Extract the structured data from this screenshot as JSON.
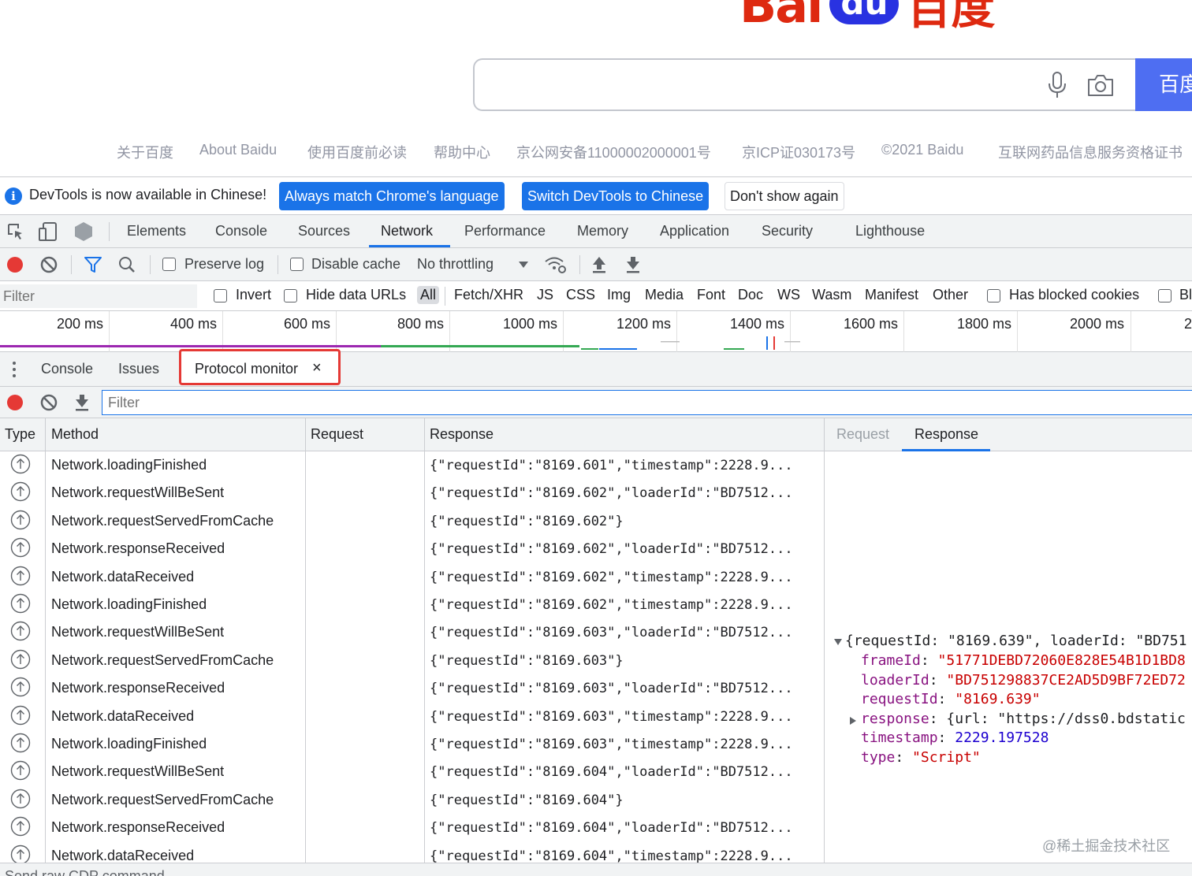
{
  "baidu": {
    "logo_latin": "Bai",
    "logo_badge": "du",
    "logo_chinese": "百度",
    "search_button": "百度一下",
    "footer_links": [
      "关于百度",
      "About Baidu",
      "使用百度前必读",
      "帮助中心",
      "京公网安备11000002000001号",
      "京ICP证030173号",
      "©2021 Baidu",
      "互联网药品信息服务资格证书"
    ]
  },
  "infobar": {
    "message": "DevTools is now available in Chinese!",
    "btn_match": "Always match Chrome's language",
    "btn_switch": "Switch DevTools to Chinese",
    "btn_dismiss": "Don't show again"
  },
  "main_tabs": [
    "Elements",
    "Console",
    "Sources",
    "Network",
    "Performance",
    "Memory",
    "Application",
    "Security",
    "Lighthouse"
  ],
  "network_toolbar": {
    "preserve_log": "Preserve log",
    "disable_cache": "Disable cache",
    "throttling": "No throttling"
  },
  "filter_bar": {
    "placeholder": "Filter",
    "invert": "Invert",
    "hide_data_urls": "Hide data URLs",
    "types": [
      "All",
      "Fetch/XHR",
      "JS",
      "CSS",
      "Img",
      "Media",
      "Font",
      "Doc",
      "WS",
      "Wasm",
      "Manifest",
      "Other"
    ],
    "has_blocked_cookies": "Has blocked cookies",
    "blocked_requests": "Bl"
  },
  "timeline": {
    "ticks": [
      "200 ms",
      "400 ms",
      "600 ms",
      "800 ms",
      "1000 ms",
      "1200 ms",
      "1400 ms",
      "1600 ms",
      "1800 ms",
      "2000 ms",
      "2"
    ]
  },
  "drawer": {
    "tabs": [
      "Console",
      "Issues",
      "Protocol monitor"
    ],
    "close_glyph": "×",
    "filter_placeholder": "Filter"
  },
  "table": {
    "headers": {
      "type": "Type",
      "method": "Method",
      "request": "Request",
      "response": "Response"
    },
    "rows": [
      {
        "method": "Network.loadingFinished",
        "response": "{\"requestId\":\"8169.601\",\"timestamp\":2228.9..."
      },
      {
        "method": "Network.requestWillBeSent",
        "response": "{\"requestId\":\"8169.602\",\"loaderId\":\"BD7512..."
      },
      {
        "method": "Network.requestServedFromCache",
        "response": "{\"requestId\":\"8169.602\"}"
      },
      {
        "method": "Network.responseReceived",
        "response": "{\"requestId\":\"8169.602\",\"loaderId\":\"BD7512..."
      },
      {
        "method": "Network.dataReceived",
        "response": "{\"requestId\":\"8169.602\",\"timestamp\":2228.9..."
      },
      {
        "method": "Network.loadingFinished",
        "response": "{\"requestId\":\"8169.602\",\"timestamp\":2228.9..."
      },
      {
        "method": "Network.requestWillBeSent",
        "response": "{\"requestId\":\"8169.603\",\"loaderId\":\"BD7512..."
      },
      {
        "method": "Network.requestServedFromCache",
        "response": "{\"requestId\":\"8169.603\"}"
      },
      {
        "method": "Network.responseReceived",
        "response": "{\"requestId\":\"8169.603\",\"loaderId\":\"BD7512..."
      },
      {
        "method": "Network.dataReceived",
        "response": "{\"requestId\":\"8169.603\",\"timestamp\":2228.9..."
      },
      {
        "method": "Network.loadingFinished",
        "response": "{\"requestId\":\"8169.603\",\"timestamp\":2228.9..."
      },
      {
        "method": "Network.requestWillBeSent",
        "response": "{\"requestId\":\"8169.604\",\"loaderId\":\"BD7512..."
      },
      {
        "method": "Network.requestServedFromCache",
        "response": "{\"requestId\":\"8169.604\"}"
      },
      {
        "method": "Network.responseReceived",
        "response": "{\"requestId\":\"8169.604\",\"loaderId\":\"BD7512..."
      },
      {
        "method": "Network.dataReceived",
        "response": "{\"requestId\":\"8169.604\",\"timestamp\":2228.9..."
      }
    ]
  },
  "detail": {
    "tab_request": "Request",
    "tab_response": "Response",
    "summary": "{requestId: \"8169.639\", loaderId: \"BD751",
    "fields": [
      {
        "key": "frameId",
        "value": "\"51771DEBD72060E828E54B1D1BD8",
        "kind": "string"
      },
      {
        "key": "loaderId",
        "value": "\"BD751298837CE2AD5D9BF72ED72",
        "kind": "string"
      },
      {
        "key": "requestId",
        "value": "\"8169.639\"",
        "kind": "string"
      },
      {
        "key": "response",
        "value": "{url: \"https://dss0.bdstatic",
        "kind": "object"
      },
      {
        "key": "timestamp",
        "value": "2229.197528",
        "kind": "number"
      },
      {
        "key": "type",
        "value": "\"Script\"",
        "kind": "string"
      }
    ]
  },
  "watermark": "@稀土掘金技术社区",
  "bottom_strip": "Send raw CDP command",
  "colors": {
    "accent": "#1a73e8",
    "highlight_box": "#e53935",
    "record": "#e53935",
    "baidu_red": "#de2910",
    "baidu_blue": "#2932e1"
  }
}
